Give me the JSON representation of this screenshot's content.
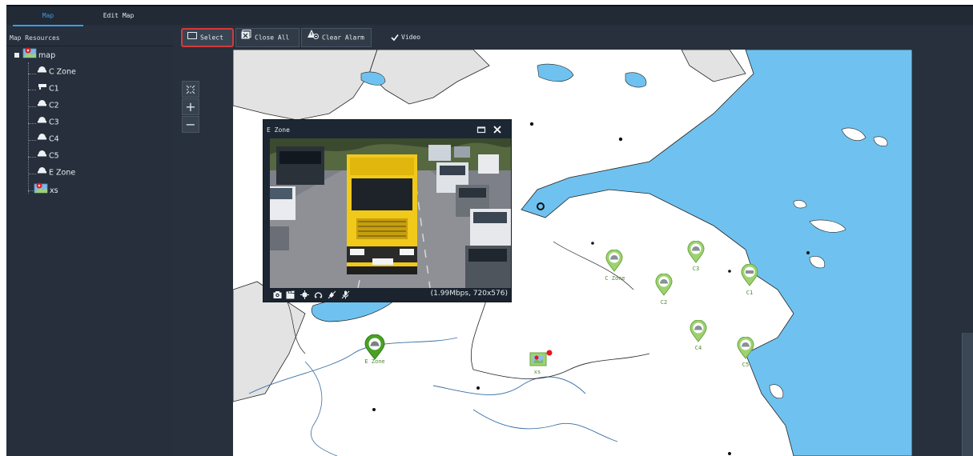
{
  "tabs": [
    {
      "label": "Map",
      "active": true
    },
    {
      "label": "Edit Map",
      "active": false
    }
  ],
  "sidebar": {
    "header": "Map Resources",
    "root": "map",
    "items": [
      {
        "label": "C Zone",
        "icon": "dome-camera-icon"
      },
      {
        "label": "C1",
        "icon": "bullet-camera-icon"
      },
      {
        "label": "C2",
        "icon": "dome-camera-icon"
      },
      {
        "label": "C3",
        "icon": "dome-camera-icon"
      },
      {
        "label": "C4",
        "icon": "dome-camera-icon"
      },
      {
        "label": "C5",
        "icon": "dome-camera-icon"
      },
      {
        "label": "E Zone",
        "icon": "dome-camera-icon"
      },
      {
        "label": "xs",
        "icon": "map-icon"
      }
    ]
  },
  "toolbar": {
    "select_label": "Select",
    "close_all_label": "Close All",
    "clear_alarm_label": "Clear Alarm",
    "video_label": "Video",
    "video_checked": true
  },
  "zoom": {
    "fit": "fit-icon",
    "in": "+",
    "out": "−"
  },
  "map_markers": [
    {
      "label": "C Zone",
      "type": "camera"
    },
    {
      "label": "C1",
      "type": "camera"
    },
    {
      "label": "C2",
      "type": "camera"
    },
    {
      "label": "C3",
      "type": "camera"
    },
    {
      "label": "C4",
      "type": "camera"
    },
    {
      "label": "C5",
      "type": "camera"
    },
    {
      "label": "E Zone",
      "type": "camera",
      "active": true
    },
    {
      "label": "xs",
      "type": "submap",
      "alarm": true
    }
  ],
  "popup": {
    "title": "E Zone",
    "bitrate": "(1.99Mbps, 720x576)"
  },
  "colors": {
    "accent": "#3c9be8",
    "panel": "#27303c",
    "water": "#6fc2ef",
    "land_gray": "#e3e3e3",
    "marker_green": "#8fcf63",
    "marker_active": "#4aa126",
    "alarm_red": "#e5161d",
    "select_highlight": "#d33a3a"
  }
}
